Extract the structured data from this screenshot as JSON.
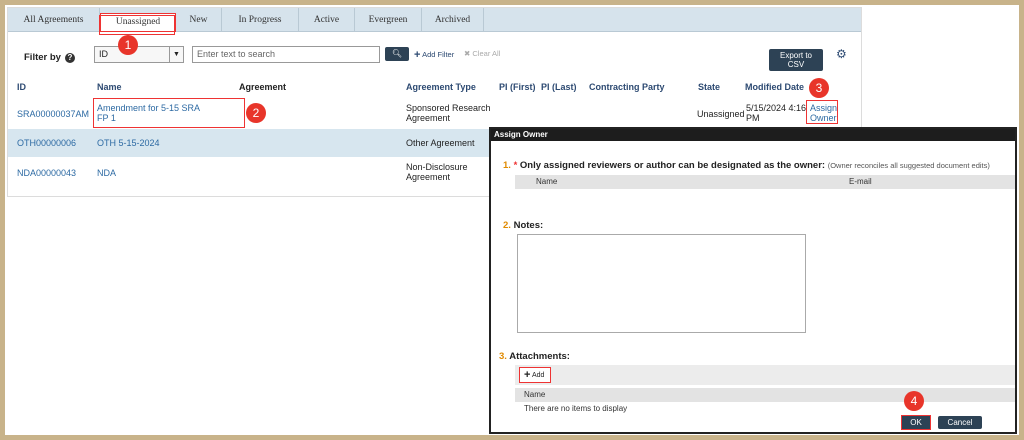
{
  "tabs": [
    "All Agreements",
    "Unassigned",
    "New",
    "In Progress",
    "Active",
    "Evergreen",
    "Archived"
  ],
  "active_tab": "Unassigned",
  "filter": {
    "label": "Filter by",
    "field_value": "ID",
    "search_placeholder": "Enter text to search",
    "add_filter": "Add Filter",
    "clear_all": "Clear All"
  },
  "export_button": "Export to CSV",
  "columns": [
    "ID",
    "Name",
    "Agreement",
    "Agreement Type",
    "PI (First)",
    "PI (Last)",
    "Contracting Party",
    "State",
    "Modified Date"
  ],
  "rows": [
    {
      "id": "SRA00000037AM",
      "name_1": "Amendment for 5-15 SRA",
      "name_2": "FP 1",
      "type_1": "Sponsored Research",
      "type_2": "Agreement",
      "state": "Unassigned",
      "date_1": "5/15/2024 4:16",
      "date_2": "PM",
      "action_1": "Assign",
      "action_2": "Owner"
    },
    {
      "id": "OTH00000006",
      "name_1": "OTH 5-15-2024",
      "type_1": "Other Agreement"
    },
    {
      "id": "NDA00000043",
      "name_1": "NDA",
      "type_1": "Non-Disclosure",
      "type_2": "Agreement"
    }
  ],
  "badges": [
    "1",
    "2",
    "3",
    "4"
  ],
  "dialog": {
    "title": "Assign Owner",
    "s1_num": "1.",
    "s1_star": "*",
    "s1_label": "Only assigned reviewers or author can be designated as the owner:",
    "s1_sub": "(Owner reconciles all suggested document edits)",
    "col_name": "Name",
    "col_email": "E-mail",
    "s2_num": "2.",
    "s2_label": "Notes:",
    "s3_num": "3.",
    "s3_label": "Attachments:",
    "add_label": "Add",
    "att_col_name": "Name",
    "empty_text": "There are no items to display",
    "ok": "OK",
    "cancel": "Cancel"
  },
  "colors": {
    "accent": "#2d4255",
    "highlight": "#e33333",
    "badge": "#e8352a",
    "link": "#2d6aa3",
    "frame": "#c8b38a"
  }
}
